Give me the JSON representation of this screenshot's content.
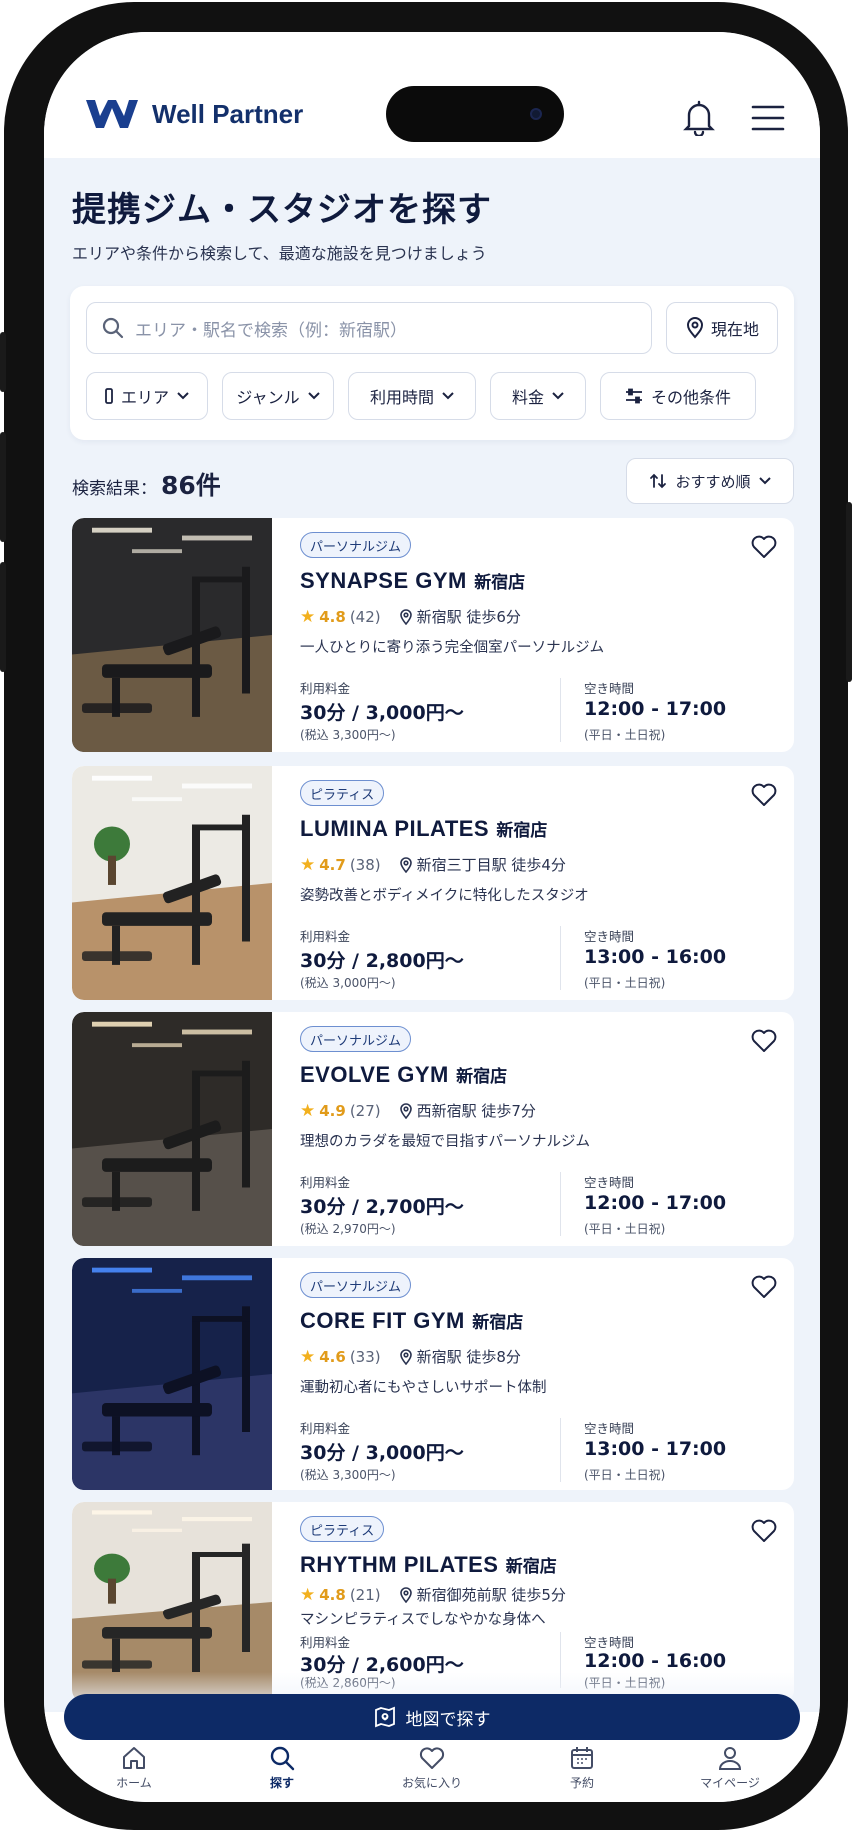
{
  "app": {
    "name": "Well Partner"
  },
  "header": {
    "bell_icon": "bell-icon",
    "menu_icon": "hamburger-menu-icon"
  },
  "page": {
    "title": "提携ジム・スタジオを探す",
    "subtitle": "エリアや条件から検索して、最適な施設を見つけましょう"
  },
  "search": {
    "placeholder": "エリア・駅名で検索（例：新宿駅）",
    "location_button": "現在地"
  },
  "filters": [
    {
      "label": "エリア"
    },
    {
      "label": "ジャンル"
    },
    {
      "label": "利用時間"
    },
    {
      "label": "料金"
    },
    {
      "label": "その他条件"
    }
  ],
  "results": {
    "label": "検索結果：",
    "count": "86件"
  },
  "sort": {
    "label": "おすすめ順"
  },
  "labels": {
    "price": "利用料金",
    "available": "空き時間"
  },
  "facilities": [
    {
      "tag": "パーソナルジム",
      "name_en": "SYNAPSE GYM",
      "name_jp": "新宿店",
      "rating": "4.8",
      "reviews": "(42)",
      "station": "新宿駅 徒歩6分",
      "description": "一人ひとりに寄り添う完全個室パーソナルジム",
      "price": "30分 / 3,000円〜",
      "price_tax": "(税込 3,300円〜)",
      "hours": "12:00 - 17:00",
      "days": "(平日・土日祝)"
    },
    {
      "tag": "ピラティス",
      "name_en": "LUMINA PILATES",
      "name_jp": "新宿店",
      "rating": "4.7",
      "reviews": "(38)",
      "station": "新宿三丁目駅 徒歩4分",
      "description": "姿勢改善とボディメイクに特化したスタジオ",
      "price": "30分 / 2,800円〜",
      "price_tax": "(税込 3,000円〜)",
      "hours": "13:00 - 16:00",
      "days": "(平日・土日祝)"
    },
    {
      "tag": "パーソナルジム",
      "name_en": "EVOLVE GYM",
      "name_jp": "新宿店",
      "rating": "4.9",
      "reviews": "(27)",
      "station": "西新宿駅 徒歩7分",
      "description": "理想のカラダを最短で目指すパーソナルジム",
      "price": "30分 / 2,700円〜",
      "price_tax": "(税込 2,970円〜)",
      "hours": "12:00 - 17:00",
      "days": "(平日・土日祝)"
    },
    {
      "tag": "パーソナルジム",
      "name_en": "CORE FIT GYM",
      "name_jp": "新宿店",
      "rating": "4.6",
      "reviews": "(33)",
      "station": "新宿駅 徒歩8分",
      "description": "運動初心者にもやさしいサポート体制",
      "price": "30分 / 3,000円〜",
      "price_tax": "(税込 3,300円〜)",
      "hours": "13:00 - 17:00",
      "days": "(平日・土日祝)"
    },
    {
      "tag": "ピラティス",
      "name_en": "RHYTHM PILATES",
      "name_jp": "新宿店",
      "rating": "4.8",
      "reviews": "(21)",
      "station": "新宿御苑前駅 徒歩5分",
      "description": "マシンピラティスでしなやかな身体へ",
      "price": "30分 / 2,600円〜",
      "price_tax": "(税込 2,860円〜)",
      "hours": "12:00 - 16:00",
      "days": "(平日・土日祝)"
    }
  ],
  "map_button": {
    "label": "地図で探す"
  },
  "tabs": [
    {
      "label": "ホーム",
      "icon": "home-icon"
    },
    {
      "label": "探す",
      "icon": "search-icon",
      "active": true
    },
    {
      "label": "お気に入り",
      "icon": "heart-icon"
    },
    {
      "label": "予約",
      "icon": "calendar-icon"
    },
    {
      "label": "マイページ",
      "icon": "user-icon"
    }
  ],
  "colors": {
    "brand": "#13306b",
    "accent_button": "#0d2a66",
    "star": "#f2b01e",
    "background": "#eef3fa"
  }
}
